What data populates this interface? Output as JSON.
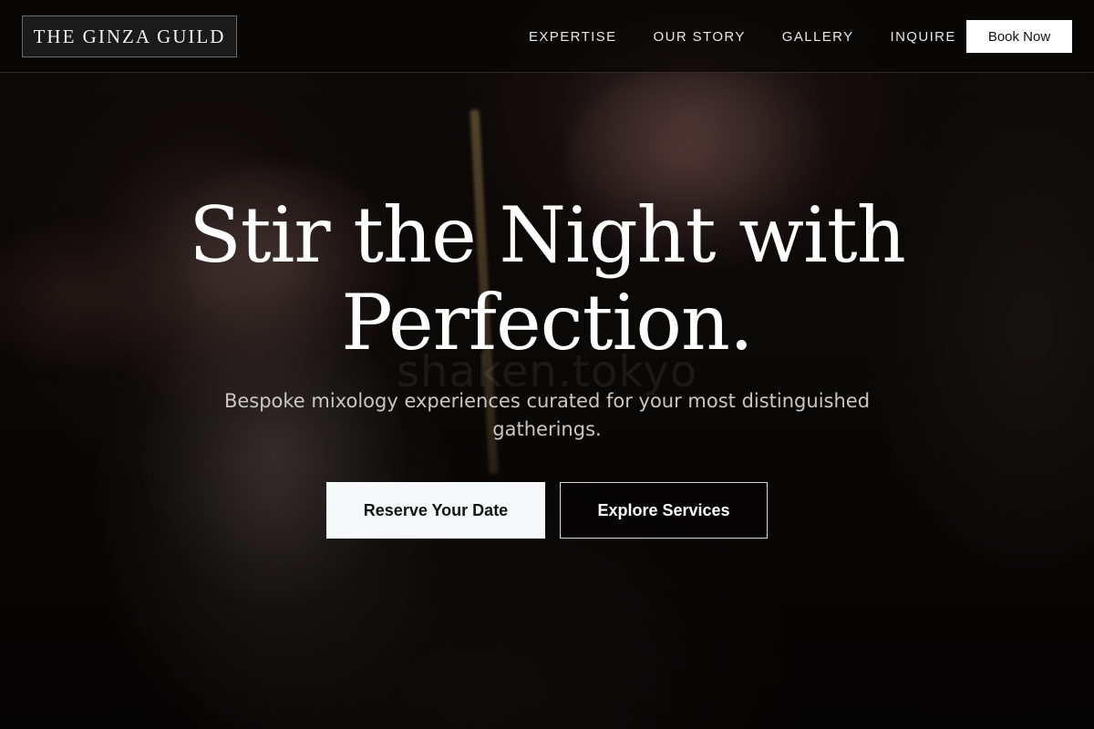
{
  "header": {
    "logo_text": "THE GINZA GUILD",
    "nav": [
      {
        "label": "EXPERTISE"
      },
      {
        "label": "OUR STORY"
      },
      {
        "label": "GALLERY"
      },
      {
        "label": "INQUIRE"
      }
    ],
    "book_label": "Book Now"
  },
  "hero": {
    "title_line1": "Stir the Night with",
    "title_line2": "Perfection.",
    "subtitle": "Bespoke mixology experiences curated for your most distinguished gatherings.",
    "watermark": "shaken.tokyo",
    "primary_cta": "Reserve Your Date",
    "secondary_cta": "Explore Services"
  },
  "colors": {
    "background": "#0b0808",
    "text": "#ffffff",
    "subtitle": "#c9c6c4",
    "button_light": "#f7f8fa"
  }
}
